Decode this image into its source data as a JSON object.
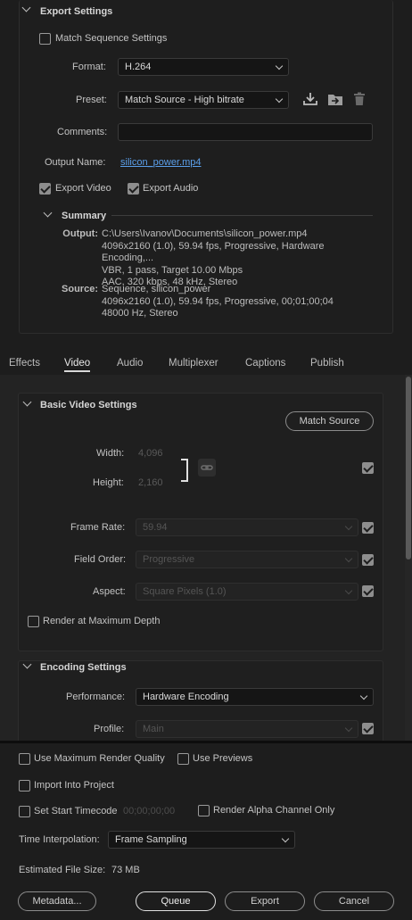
{
  "export_settings": {
    "title": "Export Settings",
    "match_sequence_label": "Match Sequence Settings",
    "format_label": "Format:",
    "format_value": "H.264",
    "preset_label": "Preset:",
    "preset_value": "Match Source - High bitrate",
    "comments_label": "Comments:",
    "comments_value": "",
    "output_name_label": "Output Name:",
    "output_name_value": "silicon_power.mp4",
    "export_video_label": "Export Video",
    "export_audio_label": "Export Audio",
    "export_video_checked": true,
    "export_audio_checked": true
  },
  "summary": {
    "title": "Summary",
    "output_key": "Output:",
    "output_lines": [
      "C:\\Users\\Ivanov\\Documents\\silicon_power.mp4",
      "4096x2160 (1.0), 59.94 fps, Progressive, Hardware Encoding,...",
      "VBR, 1 pass, Target 10.00 Mbps",
      "AAC, 320 kbps, 48 kHz, Stereo"
    ],
    "source_key": "Source:",
    "source_lines": [
      "Sequence, silicon_power",
      "4096x2160 (1.0), 59.94 fps, Progressive, 00;01;00;04",
      "48000 Hz, Stereo"
    ]
  },
  "tabs": [
    "Effects",
    "Video",
    "Audio",
    "Multiplexer",
    "Captions",
    "Publish"
  ],
  "active_tab": "Video",
  "basic_video": {
    "title": "Basic Video Settings",
    "match_source_label": "Match Source",
    "width_label": "Width:",
    "width_value": "4,096",
    "height_label": "Height:",
    "height_value": "2,160",
    "frame_rate_label": "Frame Rate:",
    "frame_rate_value": "59.94",
    "field_order_label": "Field Order:",
    "field_order_value": "Progressive",
    "aspect_label": "Aspect:",
    "aspect_value": "Square Pixels (1.0)",
    "render_max_depth_label": "Render at Maximum Depth"
  },
  "encoding": {
    "title": "Encoding Settings",
    "performance_label": "Performance:",
    "performance_value": "Hardware Encoding",
    "profile_label": "Profile:",
    "profile_value": "Main"
  },
  "footer": {
    "max_render_quality_label": "Use Maximum Render Quality",
    "use_previews_label": "Use Previews",
    "import_into_project_label": "Import Into Project",
    "set_start_timecode_label": "Set Start Timecode",
    "start_timecode_value": "00;00;00;00",
    "render_alpha_label": "Render Alpha Channel Only",
    "time_interp_label": "Time Interpolation:",
    "time_interp_value": "Frame Sampling",
    "est_size_label": "Estimated File Size:",
    "est_size_value": "73 MB",
    "metadata_label": "Metadata...",
    "queue_label": "Queue",
    "export_label": "Export",
    "cancel_label": "Cancel"
  },
  "colors": {
    "background": "#1d1d1d",
    "link": "#5b9fea",
    "accent_border": "#e0e0e0"
  }
}
